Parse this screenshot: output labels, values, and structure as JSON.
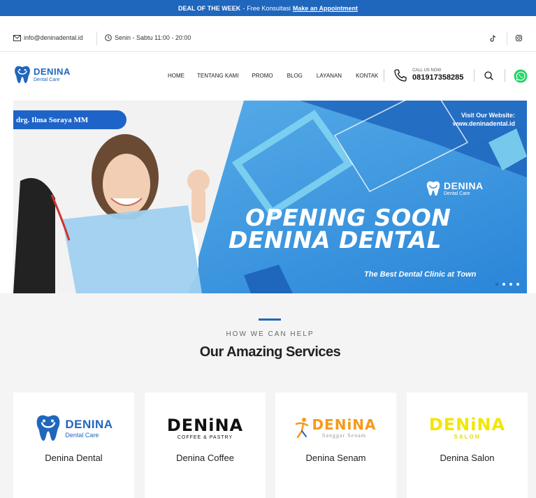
{
  "promo": {
    "deal": "DEAL OF THE WEEK",
    "sep": "-",
    "text": "Free Konsultasi",
    "cta": "Make an Appointment"
  },
  "info": {
    "email": "info@deninadental.id",
    "hours": "Senin - Sabtu 11:00 - 20:00"
  },
  "header": {
    "logo_name": "DENINA",
    "logo_sub": "Dental Care",
    "nav": [
      "HOME",
      "TENTANG KAMI",
      "PROMO",
      "BLOG",
      "LAYANAN",
      "KONTAK"
    ],
    "call_label": "CALL US NOW",
    "call_number": "081917358285"
  },
  "hero": {
    "doctor": "drg. Ilma Soraya MM",
    "visit_label": "Visit Our Website:",
    "visit_url": "www.deninadental.id",
    "logo_name": "DENINA",
    "logo_sub": "Dental Care",
    "line1": "OPENING SOON",
    "line2": "DENINA DENTAL",
    "tagline": "The Best Dental Clinic at Town",
    "slides": 4,
    "active_slide": 1
  },
  "services": {
    "kicker": "HOW WE CAN HELP",
    "title": "Our Amazing Services",
    "cards": [
      {
        "title": "Denina Dental",
        "brand": "DENINA",
        "brand_sub": "Dental Care"
      },
      {
        "title": "Denina Coffee",
        "brand": "DENiNA",
        "brand_sub": "COFFEE & PASTRY"
      },
      {
        "title": "Denina Senam",
        "brand": "DENiNA",
        "brand_sub": "Sanggar Senam"
      },
      {
        "title": "Denina Salon",
        "brand": "DENiNA",
        "brand_sub": "SALON"
      }
    ]
  },
  "colors": {
    "primary": "#1f66bd",
    "whatsapp": "#25d366",
    "hero_bg": "#3b96e0",
    "section_bg": "#f4f4f4"
  }
}
